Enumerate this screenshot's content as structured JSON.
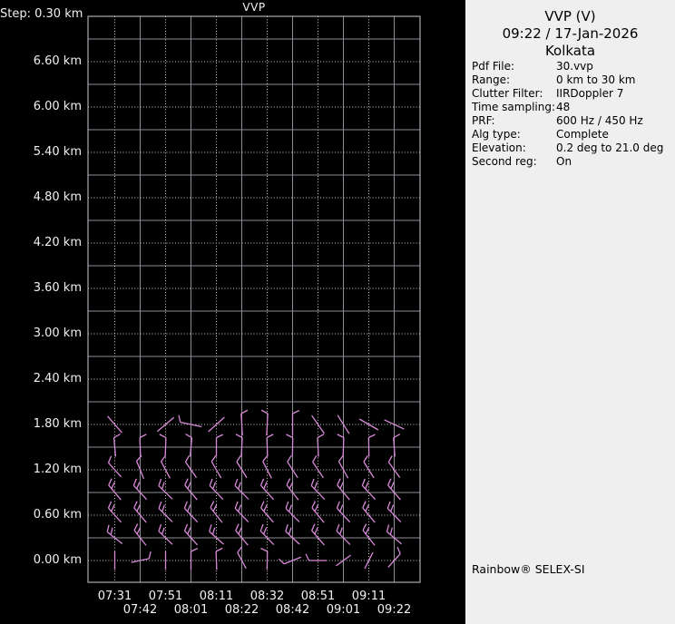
{
  "window": {
    "app": "Rainbow radar VVP display"
  },
  "colors": {
    "plot_background": "#000000",
    "panel_background": "#efefef",
    "grid_solid": "#8e8e96",
    "grid_dotted": "#d0d0d0",
    "frame": "#a8a8b0",
    "axis_text": "#f0f0f0",
    "barb": "#d98ad9",
    "panel_text": "#000000"
  },
  "plot": {
    "title": "VVP",
    "y_axis": {
      "step_label": "Step: 0.30 km",
      "labels": [
        "6.60 km",
        "6.00 km",
        "5.40 km",
        "4.80 km",
        "4.20 km",
        "3.60 km",
        "3.00 km",
        "2.40 km",
        "1.80 km",
        "1.20 km",
        "0.60 km",
        "0.00 km"
      ]
    },
    "x_axis": {
      "row1_labels": [
        "07:31",
        "07:51",
        "08:11",
        "08:32",
        "08:51",
        "09:11"
      ],
      "row2_labels": [
        "07:42",
        "08:01",
        "08:22",
        "08:42",
        "09:01",
        "09:22"
      ]
    }
  },
  "info_panel": {
    "title": "VVP (V)",
    "datetime": "09:22 / 17-Jan-2026",
    "site": "Kolkata",
    "fields": [
      {
        "label": "Pdf File:",
        "value": "30.vvp"
      },
      {
        "label": "Range:",
        "value": "0 km to 30 km"
      },
      {
        "label": "Clutter Filter:",
        "value": "IIRDoppler 7"
      },
      {
        "label": "Time sampling:",
        "value": "48"
      },
      {
        "label": "PRF:",
        "value": "600 Hz / 450 Hz"
      },
      {
        "label": "Alg type:",
        "value": "Complete"
      },
      {
        "label": "Elevation:",
        "value": "0.2 deg to 21.0 deg"
      },
      {
        "label": "Second reg:",
        "value": "On"
      }
    ],
    "footer": "Rainbow® SELEX-SI"
  },
  "chart_data": {
    "type": "wind-barb-profile",
    "title": "VVP",
    "x_times": [
      "07:31",
      "07:42",
      "07:51",
      "08:01",
      "08:11",
      "08:22",
      "08:32",
      "08:42",
      "08:51",
      "09:01",
      "09:11",
      "09:22"
    ],
    "y_height_km": {
      "min": 0.0,
      "max": 7.2,
      "tick_step": 0.3,
      "label_step": 0.6
    },
    "height_step_km": 0.3,
    "grid": "on, alternating solid/dotted every 0.3 km and every time column",
    "barb_color": "#d98ad9",
    "rows": [
      {
        "height_km": 0.0,
        "len": 20,
        "angles": [
          90,
          168,
          90,
          90,
          88,
          62,
          91,
          -22,
          0,
          -36,
          -63,
          132
        ],
        "ticks": [
          0,
          1,
          0,
          1,
          1,
          1,
          1,
          1,
          1,
          0,
          0,
          1
        ]
      },
      {
        "height_km": 0.3,
        "len": 21,
        "angles": [
          38,
          52,
          44,
          48,
          42,
          50,
          46,
          43,
          49,
          45,
          52,
          40
        ],
        "ticks": [
          2,
          2,
          2,
          2,
          2,
          2,
          2,
          2,
          2,
          2,
          2,
          2
        ]
      },
      {
        "height_km": 0.6,
        "len": 21,
        "angles": [
          48,
          50,
          45,
          47,
          52,
          46,
          49,
          45,
          51,
          47,
          50,
          46
        ],
        "ticks": [
          2,
          2,
          2,
          2,
          2,
          2,
          2,
          2,
          2,
          2,
          2,
          2
        ]
      },
      {
        "height_km": 0.9,
        "len": 21,
        "angles": [
          50,
          47,
          44,
          50,
          46,
          45,
          48,
          52,
          46,
          50,
          47,
          49
        ],
        "ticks": [
          2,
          2,
          2,
          2,
          2,
          2,
          2,
          2,
          2,
          2,
          2,
          2
        ]
      },
      {
        "height_km": 1.2,
        "len": 21,
        "angles": [
          48,
          68,
          62,
          55,
          60,
          58,
          63,
          57,
          56,
          61,
          58,
          54
        ],
        "ticks": [
          1,
          1,
          1,
          1,
          1,
          1,
          1,
          1,
          1,
          1,
          1,
          1
        ]
      },
      {
        "height_km": 1.5,
        "len": 21,
        "angles": [
          85,
          88,
          92,
          95,
          90,
          93,
          88,
          91,
          87,
          92,
          89,
          86
        ],
        "ticks": [
          1,
          1,
          1,
          1,
          1,
          1,
          1,
          1,
          1,
          1,
          1,
          1
        ]
      },
      {
        "height_km": 1.8,
        "len": 24,
        "angles": [
          49,
          null,
          -40,
          12,
          -42,
          87,
          93,
          90,
          55,
          58,
          30,
          25
        ],
        "ticks": [
          0,
          null,
          0,
          1,
          0,
          1,
          1,
          1,
          0,
          0,
          0,
          0
        ]
      }
    ]
  }
}
